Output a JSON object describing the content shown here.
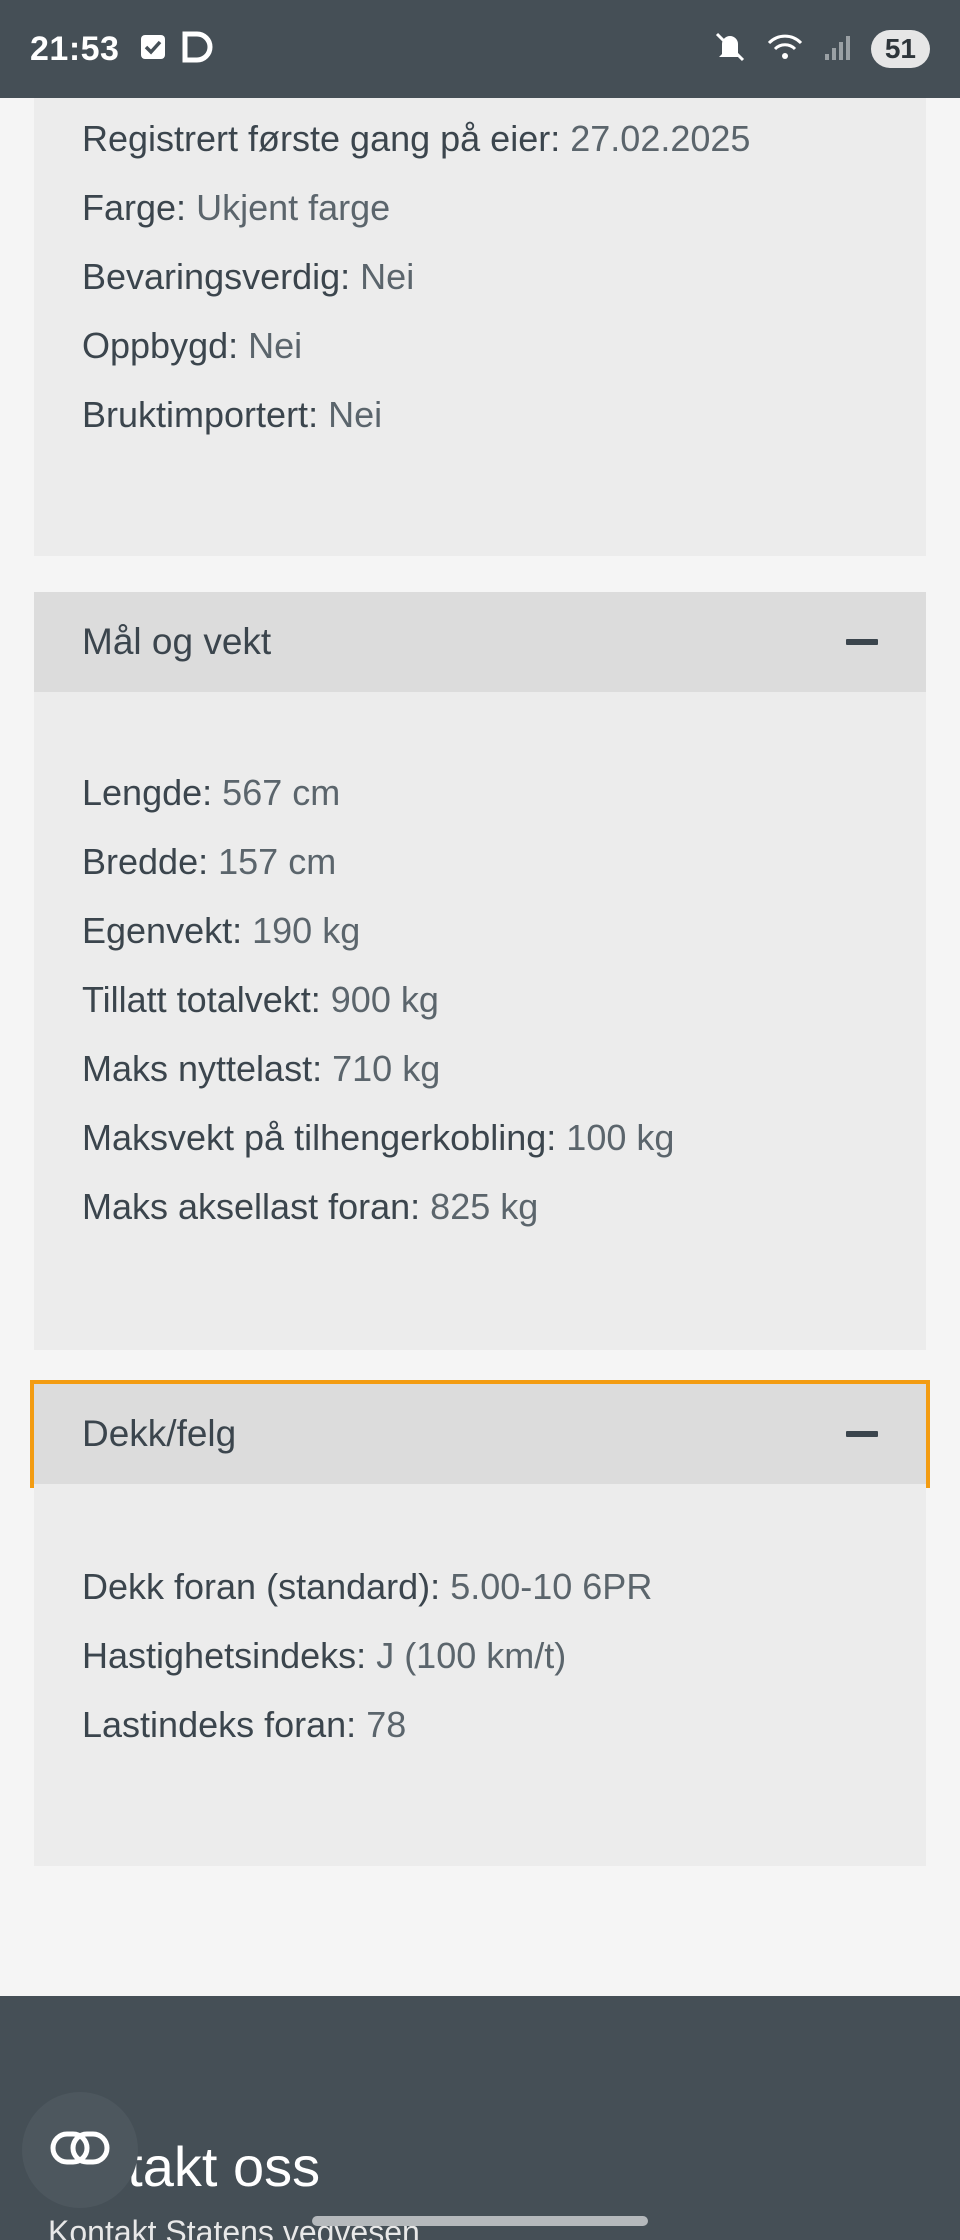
{
  "status_bar": {
    "time": "21:53",
    "battery": "51",
    "icons": [
      "checkbox-icon",
      "d-app-icon",
      "mute-icon",
      "wifi-icon",
      "signal-icon"
    ]
  },
  "vehicle_info": {
    "rows": [
      {
        "key": "Registrert første gang på eier",
        "value": "27.02.2025"
      },
      {
        "key": "Farge",
        "value": "Ukjent farge"
      },
      {
        "key": "Bevaringsverdig",
        "value": "Nei"
      },
      {
        "key": "Oppbygd",
        "value": "Nei"
      },
      {
        "key": "Bruktimportert",
        "value": "Nei"
      }
    ]
  },
  "dimensions": {
    "title": "Mål og vekt",
    "rows": [
      {
        "key": "Lengde",
        "value": "567 cm"
      },
      {
        "key": "Bredde",
        "value": "157 cm"
      },
      {
        "key": "Egenvekt",
        "value": "190 kg"
      },
      {
        "key": "Tillatt totalvekt",
        "value": "900 kg"
      },
      {
        "key": "Maks nyttelast",
        "value": "710 kg"
      },
      {
        "key": "Maksvekt på tilhengerkobling",
        "value": "100 kg"
      },
      {
        "key": "Maks aksellast foran",
        "value": "825 kg"
      }
    ]
  },
  "tires": {
    "title": "Dekk/felg",
    "rows": [
      {
        "key": "Dekk foran (standard)",
        "value": "5.00-10 6PR"
      },
      {
        "key": "Hastighetsindeks",
        "value": "J (100 km/t)"
      },
      {
        "key": "Lastindeks foran",
        "value": "78"
      }
    ]
  },
  "footer": {
    "title": "ntakt oss",
    "subtitle": "Kontakt Statens vegvesen"
  },
  "colors": {
    "accent_focus": "#f39c12",
    "header_bg": "#454f56"
  }
}
